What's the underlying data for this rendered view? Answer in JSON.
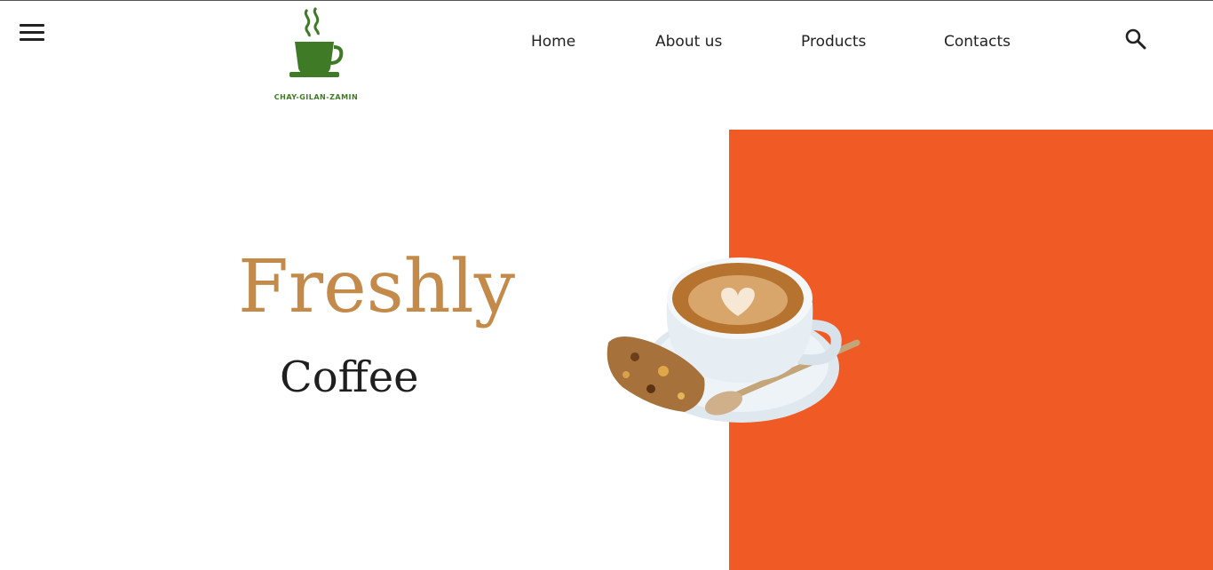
{
  "header": {
    "brand_name": "CHAY-GILAN-ZAMIN",
    "nav": [
      {
        "label": "Home"
      },
      {
        "label": "About us"
      },
      {
        "label": "Products"
      },
      {
        "label": "Contacts"
      }
    ],
    "menu_icon": "hamburger-icon",
    "search_icon": "search-icon"
  },
  "hero": {
    "title": "Freshly",
    "subtitle": "Coffee"
  },
  "colors": {
    "accent": "#f05a24",
    "title": "#c48a4a",
    "brand_green": "#3f7a27"
  }
}
